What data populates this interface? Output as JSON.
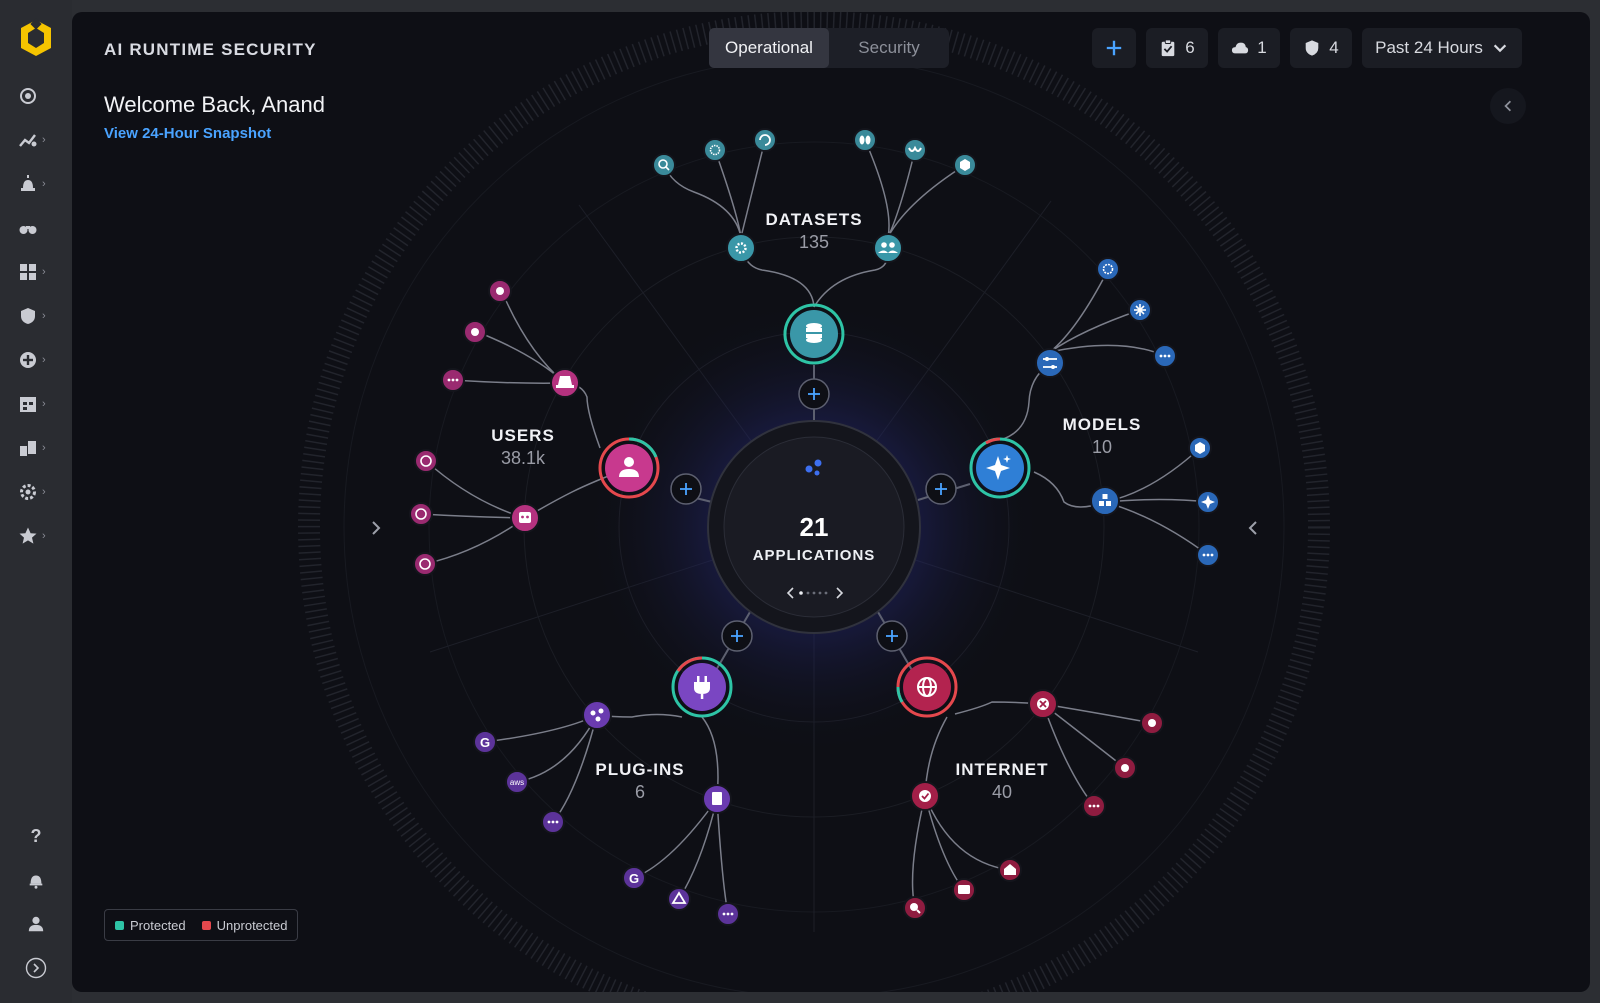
{
  "app": {
    "title": "AI RUNTIME SECURITY"
  },
  "header": {
    "tabs": [
      {
        "label": "Operational",
        "active": true
      },
      {
        "label": "Security",
        "active": false
      }
    ],
    "add_icon": "plus-icon",
    "tasks_count": "6",
    "cloud_count": "1",
    "shield_count": "4",
    "time_range": "Past 24 Hours"
  },
  "welcome": {
    "greeting": "Welcome Back, Anand",
    "snapshot_link": "View 24-Hour Snapshot"
  },
  "sidebar": {
    "items": [
      {
        "icon": "dashboard-icon"
      },
      {
        "icon": "analytics-icon"
      },
      {
        "icon": "alerts-icon"
      },
      {
        "icon": "binoculars-icon"
      },
      {
        "icon": "apps-grid-icon"
      },
      {
        "icon": "shield-icon"
      },
      {
        "icon": "add-circle-icon"
      },
      {
        "icon": "calendar-icon"
      },
      {
        "icon": "devices-icon"
      },
      {
        "icon": "settings-icon"
      },
      {
        "icon": "star-icon"
      }
    ],
    "bottom": [
      {
        "icon": "help-icon",
        "label": "?"
      },
      {
        "icon": "bell-icon"
      },
      {
        "icon": "user-icon"
      },
      {
        "icon": "expand-icon"
      }
    ]
  },
  "graph": {
    "center": {
      "count": "21",
      "label": "APPLICATIONS"
    },
    "nodes": [
      {
        "key": "datasets",
        "name": "DATASETS",
        "count": "135",
        "color": "#3a97a8"
      },
      {
        "key": "models",
        "name": "MODELS",
        "count": "10",
        "color": "#2f7fd6"
      },
      {
        "key": "internet",
        "name": "INTERNET",
        "count": "40",
        "color": "#b3234f"
      },
      {
        "key": "plugins",
        "name": "PLUG-INS",
        "count": "6",
        "color": "#7a46c2"
      },
      {
        "key": "users",
        "name": "USERS",
        "count": "38.1k",
        "color": "#c8398e"
      }
    ]
  },
  "legend": {
    "protected": {
      "label": "Protected",
      "color": "#2ec4a6"
    },
    "unprotected": {
      "label": "Unprotected",
      "color": "#e5484d"
    }
  }
}
